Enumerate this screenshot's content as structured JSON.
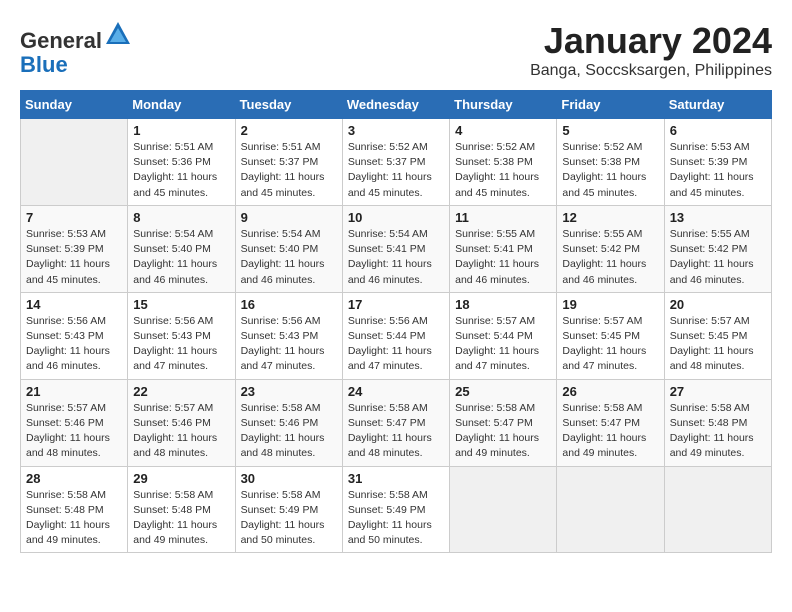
{
  "header": {
    "logo_line1": "General",
    "logo_line2": "Blue",
    "title": "January 2024",
    "subtitle": "Banga, Soccsksargen, Philippines"
  },
  "days_of_week": [
    "Sunday",
    "Monday",
    "Tuesday",
    "Wednesday",
    "Thursday",
    "Friday",
    "Saturday"
  ],
  "weeks": [
    [
      {
        "day": "",
        "info": ""
      },
      {
        "day": "1",
        "info": "Sunrise: 5:51 AM\nSunset: 5:36 PM\nDaylight: 11 hours\nand 45 minutes."
      },
      {
        "day": "2",
        "info": "Sunrise: 5:51 AM\nSunset: 5:37 PM\nDaylight: 11 hours\nand 45 minutes."
      },
      {
        "day": "3",
        "info": "Sunrise: 5:52 AM\nSunset: 5:37 PM\nDaylight: 11 hours\nand 45 minutes."
      },
      {
        "day": "4",
        "info": "Sunrise: 5:52 AM\nSunset: 5:38 PM\nDaylight: 11 hours\nand 45 minutes."
      },
      {
        "day": "5",
        "info": "Sunrise: 5:52 AM\nSunset: 5:38 PM\nDaylight: 11 hours\nand 45 minutes."
      },
      {
        "day": "6",
        "info": "Sunrise: 5:53 AM\nSunset: 5:39 PM\nDaylight: 11 hours\nand 45 minutes."
      }
    ],
    [
      {
        "day": "7",
        "info": "Sunrise: 5:53 AM\nSunset: 5:39 PM\nDaylight: 11 hours\nand 45 minutes."
      },
      {
        "day": "8",
        "info": "Sunrise: 5:54 AM\nSunset: 5:40 PM\nDaylight: 11 hours\nand 46 minutes."
      },
      {
        "day": "9",
        "info": "Sunrise: 5:54 AM\nSunset: 5:40 PM\nDaylight: 11 hours\nand 46 minutes."
      },
      {
        "day": "10",
        "info": "Sunrise: 5:54 AM\nSunset: 5:41 PM\nDaylight: 11 hours\nand 46 minutes."
      },
      {
        "day": "11",
        "info": "Sunrise: 5:55 AM\nSunset: 5:41 PM\nDaylight: 11 hours\nand 46 minutes."
      },
      {
        "day": "12",
        "info": "Sunrise: 5:55 AM\nSunset: 5:42 PM\nDaylight: 11 hours\nand 46 minutes."
      },
      {
        "day": "13",
        "info": "Sunrise: 5:55 AM\nSunset: 5:42 PM\nDaylight: 11 hours\nand 46 minutes."
      }
    ],
    [
      {
        "day": "14",
        "info": "Sunrise: 5:56 AM\nSunset: 5:43 PM\nDaylight: 11 hours\nand 46 minutes."
      },
      {
        "day": "15",
        "info": "Sunrise: 5:56 AM\nSunset: 5:43 PM\nDaylight: 11 hours\nand 47 minutes."
      },
      {
        "day": "16",
        "info": "Sunrise: 5:56 AM\nSunset: 5:43 PM\nDaylight: 11 hours\nand 47 minutes."
      },
      {
        "day": "17",
        "info": "Sunrise: 5:56 AM\nSunset: 5:44 PM\nDaylight: 11 hours\nand 47 minutes."
      },
      {
        "day": "18",
        "info": "Sunrise: 5:57 AM\nSunset: 5:44 PM\nDaylight: 11 hours\nand 47 minutes."
      },
      {
        "day": "19",
        "info": "Sunrise: 5:57 AM\nSunset: 5:45 PM\nDaylight: 11 hours\nand 47 minutes."
      },
      {
        "day": "20",
        "info": "Sunrise: 5:57 AM\nSunset: 5:45 PM\nDaylight: 11 hours\nand 48 minutes."
      }
    ],
    [
      {
        "day": "21",
        "info": "Sunrise: 5:57 AM\nSunset: 5:46 PM\nDaylight: 11 hours\nand 48 minutes."
      },
      {
        "day": "22",
        "info": "Sunrise: 5:57 AM\nSunset: 5:46 PM\nDaylight: 11 hours\nand 48 minutes."
      },
      {
        "day": "23",
        "info": "Sunrise: 5:58 AM\nSunset: 5:46 PM\nDaylight: 11 hours\nand 48 minutes."
      },
      {
        "day": "24",
        "info": "Sunrise: 5:58 AM\nSunset: 5:47 PM\nDaylight: 11 hours\nand 48 minutes."
      },
      {
        "day": "25",
        "info": "Sunrise: 5:58 AM\nSunset: 5:47 PM\nDaylight: 11 hours\nand 49 minutes."
      },
      {
        "day": "26",
        "info": "Sunrise: 5:58 AM\nSunset: 5:47 PM\nDaylight: 11 hours\nand 49 minutes."
      },
      {
        "day": "27",
        "info": "Sunrise: 5:58 AM\nSunset: 5:48 PM\nDaylight: 11 hours\nand 49 minutes."
      }
    ],
    [
      {
        "day": "28",
        "info": "Sunrise: 5:58 AM\nSunset: 5:48 PM\nDaylight: 11 hours\nand 49 minutes."
      },
      {
        "day": "29",
        "info": "Sunrise: 5:58 AM\nSunset: 5:48 PM\nDaylight: 11 hours\nand 49 minutes."
      },
      {
        "day": "30",
        "info": "Sunrise: 5:58 AM\nSunset: 5:49 PM\nDaylight: 11 hours\nand 50 minutes."
      },
      {
        "day": "31",
        "info": "Sunrise: 5:58 AM\nSunset: 5:49 PM\nDaylight: 11 hours\nand 50 minutes."
      },
      {
        "day": "",
        "info": ""
      },
      {
        "day": "",
        "info": ""
      },
      {
        "day": "",
        "info": ""
      }
    ]
  ]
}
